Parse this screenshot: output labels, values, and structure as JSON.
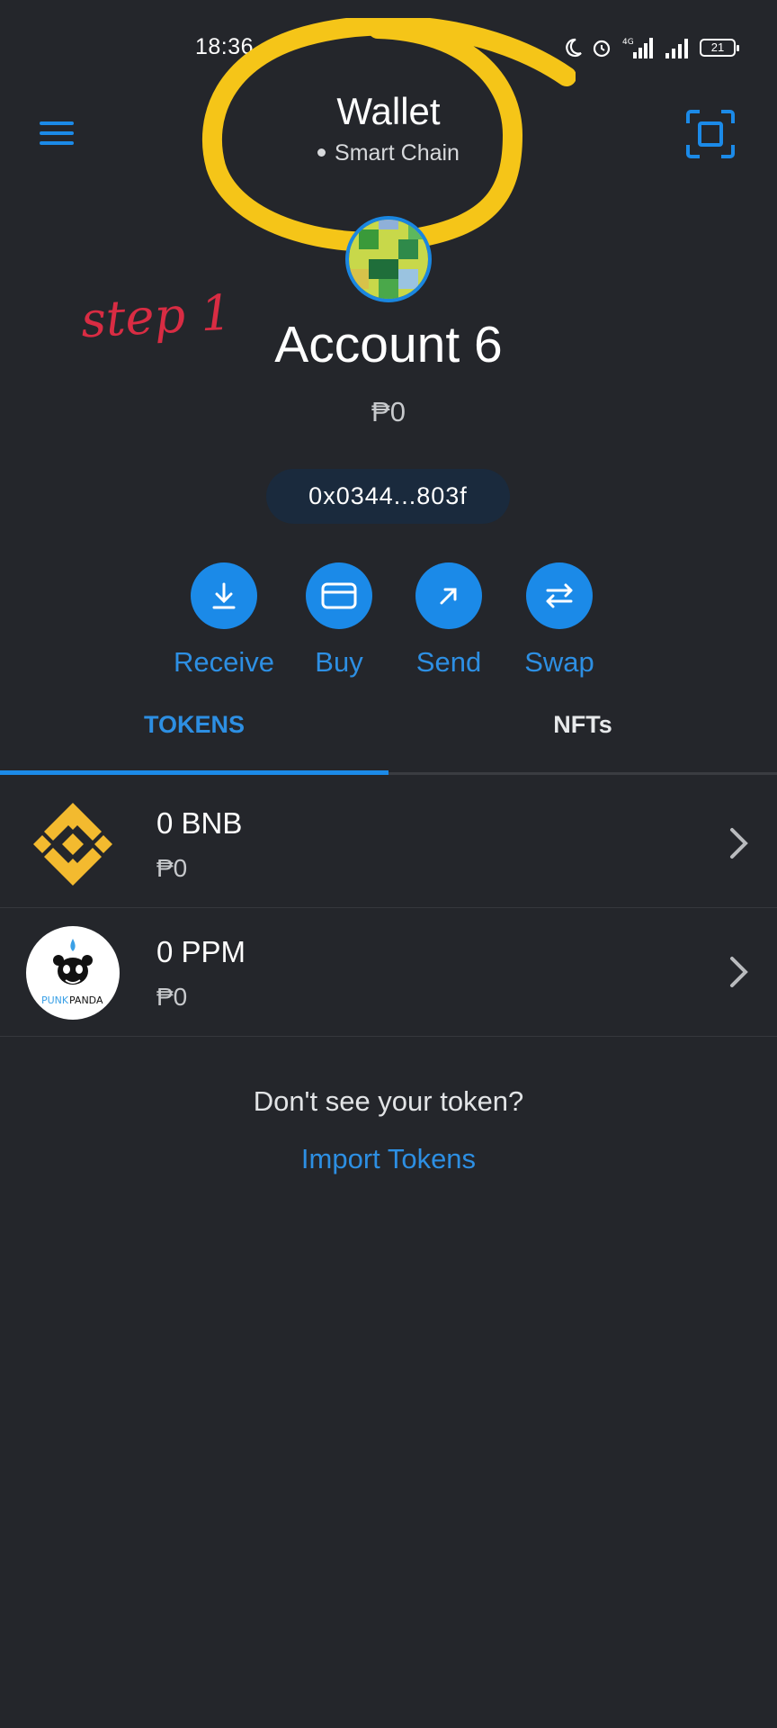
{
  "status_bar": {
    "time": "18:36",
    "network_label": "4G",
    "battery": "21"
  },
  "header": {
    "title": "Wallet",
    "network": "Smart Chain",
    "menu_icon": "hamburger-icon",
    "scan_icon": "scan-qr-icon"
  },
  "annotation": {
    "step_text": "step 1",
    "circle_color": "#f5c518",
    "step_color": "#d92c43"
  },
  "account": {
    "name": "Account 6",
    "balance": "₱0",
    "address": "0x0344...803f"
  },
  "actions": [
    {
      "label": "Receive",
      "icon": "receive-icon"
    },
    {
      "label": "Buy",
      "icon": "card-icon"
    },
    {
      "label": "Send",
      "icon": "send-arrow-icon"
    },
    {
      "label": "Swap",
      "icon": "swap-icon"
    }
  ],
  "tabs": [
    {
      "label": "TOKENS",
      "active": true
    },
    {
      "label": "NFTs",
      "active": false
    }
  ],
  "tokens": [
    {
      "amount": "0 BNB",
      "fiat": "₱0",
      "icon": "bnb-logo"
    },
    {
      "amount": "0 PPM",
      "fiat": "₱0",
      "icon": "punkpanda-logo",
      "logo_text_a": "PUNK",
      "logo_text_b": "PANDA"
    }
  ],
  "footer": {
    "prompt": "Don't see your token?",
    "import_label": "Import Tokens"
  },
  "colors": {
    "background": "#24262b",
    "accent": "#1b8ae8",
    "bnb": "#f3ba2f"
  }
}
